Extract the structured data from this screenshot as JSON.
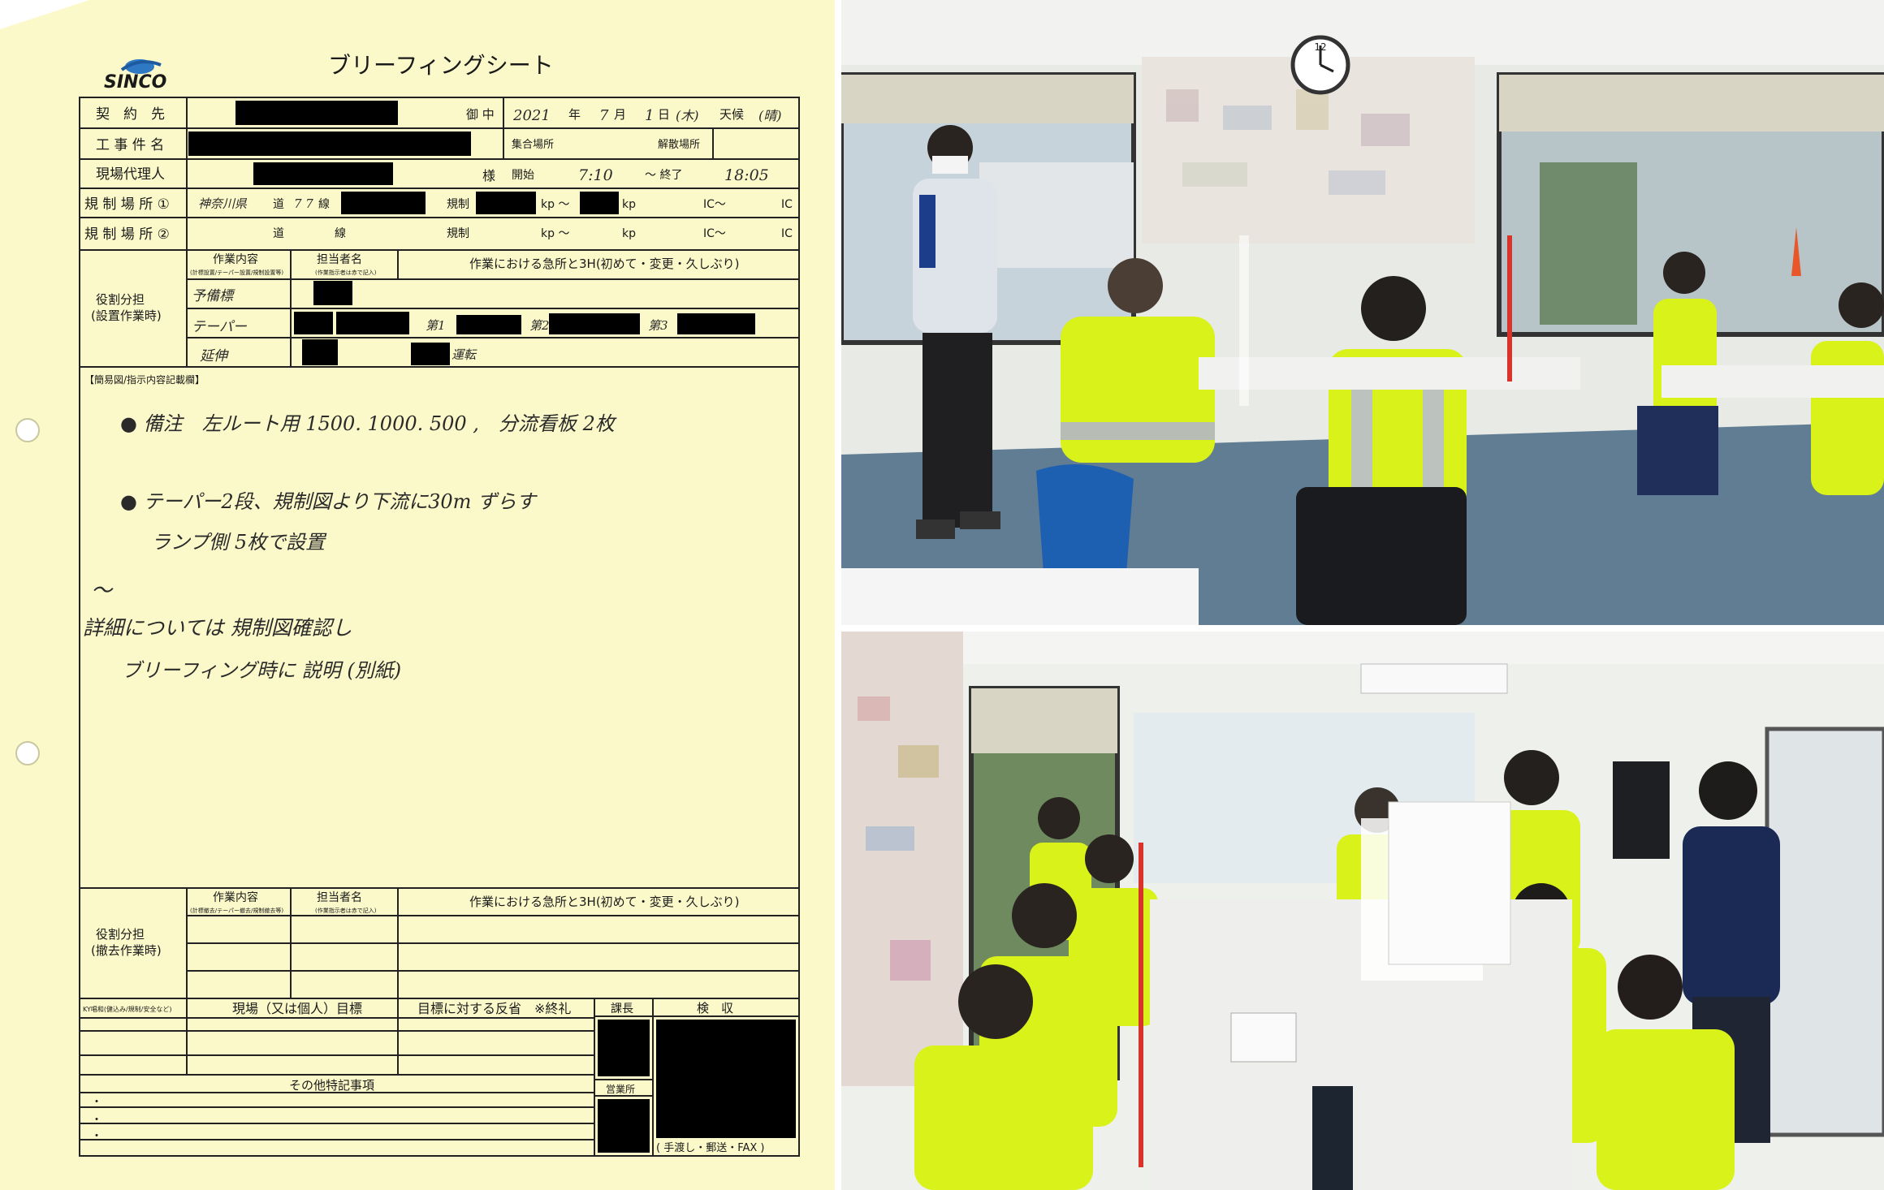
{
  "sheet": {
    "logo": "SINCO",
    "title": "ブリーフィングシート",
    "labels": {
      "contractor": "契　約　先",
      "onchu": "御 中",
      "work_name": "工 事 件 名",
      "site_agent": "現場代理人",
      "sama": "様",
      "place1": "規 制 場 所 ①",
      "place2": "規 制 場 所 ②",
      "year": "年",
      "month": "月",
      "day": "日",
      "weather": "天候",
      "gathering_place": "集合場所",
      "dispersal_place": "解散場所",
      "start": "開始",
      "end": "〜 終了",
      "road": "道",
      "route": "線",
      "kisei": "規制",
      "kp": "kp 〜",
      "kp2": "kp",
      "ic": "IC〜",
      "ic2": "IC"
    },
    "handwritten_header": {
      "year": "2021",
      "month": "7",
      "day": "1",
      "weekday": "(木)",
      "weather": "(晴)",
      "road_pref": "神奈川県",
      "road_no": "7 7",
      "start": "7:10",
      "end": "18:05"
    },
    "role_setup": {
      "title_line1": "役割分担",
      "title_line2": "(設置作業時)",
      "col_task": "作業内容",
      "col_task_sub": "(計標設置/テーパー設置/規制設置等)",
      "col_person": "担当者名",
      "col_person_sub": "(作業指示者は赤で記入)",
      "col_3h": "作業における急所と3H(初めて・変更・久しぶり)",
      "rows": [
        "予備標",
        "テーパー",
        "延伸"
      ],
      "row2_marks": [
        "第1",
        "第2",
        "第3"
      ],
      "row3_text": "運転"
    },
    "memo_label": "【簡易図/指示内容記載欄】",
    "memo_lines": [
      "● 備注　左ルート用 1500. 1000. 500 ,　分流看板 2枚",
      "● テーパー2段、規制図より下流に30m ずらす",
      "ランプ側 5枚で設置",
      "〜",
      "詳細については 規制図確認し",
      "ブリーフィング時に 説明 (別紙)"
    ],
    "role_remove": {
      "title_line1": "役割分担",
      "title_line2": "(撤去作業時)",
      "col_task": "作業内容",
      "col_task_sub": "(計標撤去/テーパー撤去/規制撤去等)",
      "col_person": "担当者名",
      "col_person_sub": "(作業指示者は赤で記入)",
      "col_3h": "作業における急所と3H(初めて・変更・久しぶり)"
    },
    "footer": {
      "ky": "KY唱和(健込み/規制/安全など)",
      "goal": "現場（又は個人）目標",
      "reflection": "目標に対する反省　※終礼",
      "kacho": "課長",
      "kenshu": "検　収",
      "other": "その他特記事項",
      "eigyo": "営業所",
      "delivery": "( 手渡し・郵送・FAX )",
      "bullets": [
        "・",
        "・",
        "・"
      ]
    }
  },
  "photos": {
    "top_clock": "12",
    "colors": {
      "vest": "#d8f21a",
      "floor": "#5f7f95",
      "wall": "#eef0ec"
    }
  }
}
